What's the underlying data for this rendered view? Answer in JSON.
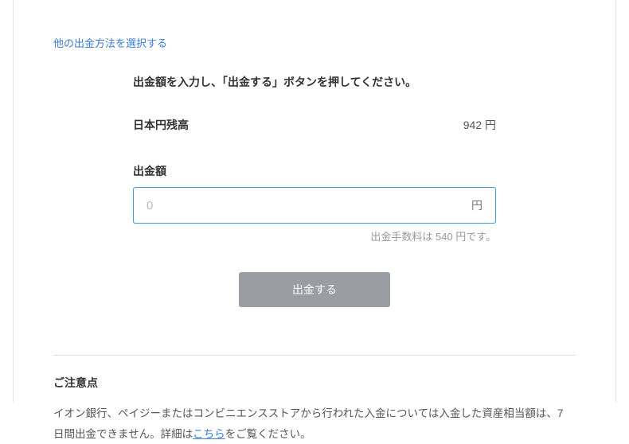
{
  "method_selection_link": "他の出金方法を選択する",
  "form": {
    "instruction": "出金額を入力し、「出金する」ボタンを押してください。",
    "balance_label": "日本円残高",
    "balance_value": "942 円",
    "amount_label": "出金額",
    "amount_placeholder": "0",
    "currency_unit": "円",
    "fee_text": "出金手数料は 540 円です。",
    "withdraw_button": "出金する"
  },
  "notice": {
    "title": "ご注意点",
    "text_before": "イオン銀行、ペイジーまたはコンビニエンスストアから行われた入金については入金した資産相当額は、7 日間出金できません。詳細は",
    "link": "こちら",
    "text_after": "をご覧ください。"
  }
}
